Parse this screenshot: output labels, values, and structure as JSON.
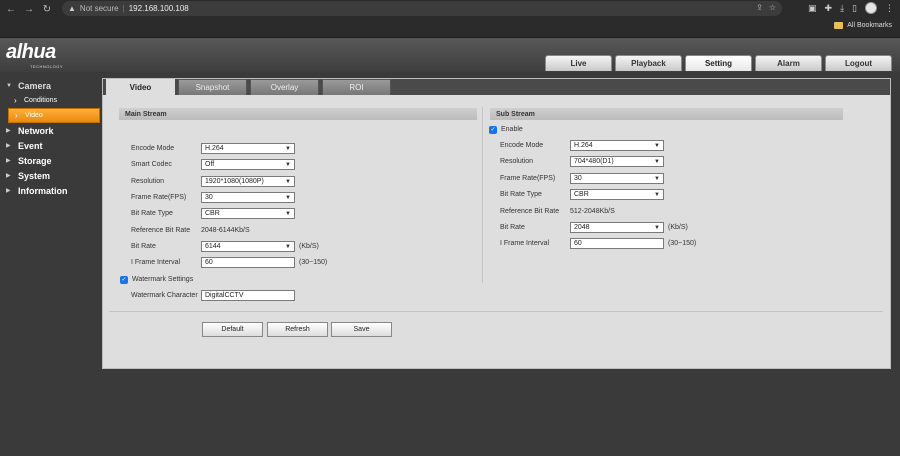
{
  "browser": {
    "not_secure": "Not secure",
    "url": "192.168.100.108",
    "all_bookmarks": "All Bookmarks"
  },
  "logo": {
    "brand": "alhua",
    "tagline": "TECHNOLOGY"
  },
  "top_tabs": [
    "Live",
    "Playback",
    "Setting",
    "Alarm",
    "Logout"
  ],
  "sidebar": {
    "camera": "Camera",
    "conditions": "Conditions",
    "video": "Video",
    "network": "Network",
    "event": "Event",
    "storage": "Storage",
    "system": "System",
    "information": "Information"
  },
  "sub_tabs": [
    "Video",
    "Snapshot",
    "Overlay",
    "ROI"
  ],
  "main_stream": {
    "title": "Main Stream",
    "encode_mode_label": "Encode Mode",
    "encode_mode": "H.264",
    "smart_codec_label": "Smart Codec",
    "smart_codec": "Off",
    "resolution_label": "Resolution",
    "resolution": "1920*1080(1080P)",
    "fps_label": "Frame Rate(FPS)",
    "fps": "30",
    "bitrate_type_label": "Bit Rate Type",
    "bitrate_type": "CBR",
    "ref_bitrate_label": "Reference Bit Rate",
    "ref_bitrate": "2048-6144Kb/S",
    "bitrate_label": "Bit Rate",
    "bitrate": "6144",
    "bitrate_unit": "(Kb/S)",
    "iframe_label": "I Frame Interval",
    "iframe": "60",
    "iframe_range": "(30~150)",
    "watermark_settings": "Watermark Settings",
    "watermark_char_label": "Watermark Character",
    "watermark_char": "DigitalCCTV"
  },
  "sub_stream": {
    "title": "Sub Stream",
    "enable": "Enable",
    "encode_mode_label": "Encode Mode",
    "encode_mode": "H.264",
    "resolution_label": "Resolution",
    "resolution": "704*480(D1)",
    "fps_label": "Frame Rate(FPS)",
    "fps": "30",
    "bitrate_type_label": "Bit Rate Type",
    "bitrate_type": "CBR",
    "ref_bitrate_label": "Reference Bit Rate",
    "ref_bitrate": "512-2048Kb/S",
    "bitrate_label": "Bit Rate",
    "bitrate": "2048",
    "bitrate_unit": "(Kb/S)",
    "iframe_label": "I Frame Interval",
    "iframe": "60",
    "iframe_range": "(30~150)"
  },
  "buttons": {
    "default": "Default",
    "refresh": "Refresh",
    "save": "Save"
  }
}
